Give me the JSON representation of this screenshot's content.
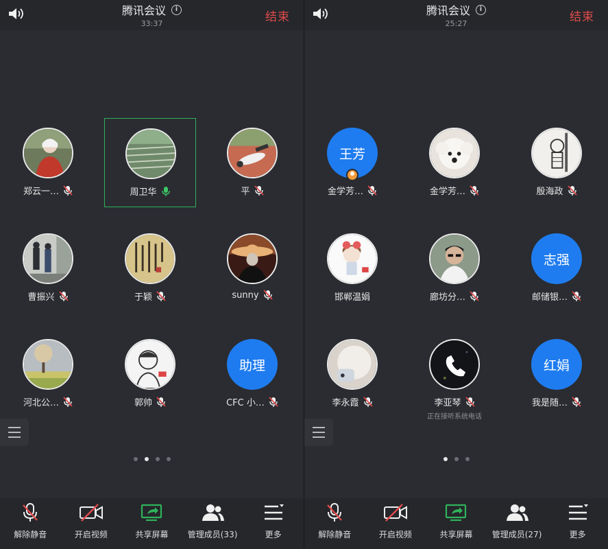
{
  "screens": [
    {
      "title": "腾讯会议",
      "timer": "33:37",
      "end_label": "结束",
      "tiles": [
        {
          "name": "郑云一…",
          "mic": "muted",
          "avatar_type": "photo",
          "avatar_icon": "woman-red-coat-photo"
        },
        {
          "name": "周卫华",
          "mic": "active",
          "avatar_type": "photo",
          "avatar_icon": "field-landscape-photo",
          "speaking": true
        },
        {
          "name": "平",
          "mic": "muted",
          "avatar_type": "photo",
          "avatar_icon": "reclining-person-photo"
        },
        {
          "name": "曹振兴",
          "mic": "muted",
          "avatar_type": "photo",
          "avatar_icon": "street-walkers-photo"
        },
        {
          "name": "于颖",
          "mic": "muted",
          "avatar_type": "photo",
          "avatar_icon": "calligraphy-photo"
        },
        {
          "name": "sunny",
          "mic": "muted",
          "avatar_type": "photo",
          "avatar_icon": "hat-silhouette-photo"
        },
        {
          "name": "河北公…",
          "mic": "muted",
          "avatar_type": "photo",
          "avatar_icon": "tree-field-photo"
        },
        {
          "name": "郭帅",
          "mic": "muted",
          "avatar_type": "photo",
          "avatar_icon": "cartoon-sketch-avatar"
        },
        {
          "name": "CFC 小…",
          "mic": "muted",
          "avatar_type": "text",
          "avatar_text": "助理"
        }
      ],
      "dots": {
        "count": 4,
        "active": 1
      },
      "toolbar": [
        {
          "label": "解除静音",
          "icon": "mic-muted-icon"
        },
        {
          "label": "开启视频",
          "icon": "video-off-icon"
        },
        {
          "label": "共享屏幕",
          "icon": "share-screen-icon"
        },
        {
          "label": "管理成员(33)",
          "icon": "members-icon"
        },
        {
          "label": "更多",
          "icon": "more-menu-icon"
        }
      ]
    },
    {
      "title": "腾讯会议",
      "timer": "25:27",
      "end_label": "结束",
      "tiles": [
        {
          "name": "金学芳…",
          "mic": "muted",
          "avatar_type": "text",
          "avatar_text": "王芳",
          "host": true
        },
        {
          "name": "金学芳…",
          "mic": "muted",
          "avatar_type": "photo",
          "avatar_icon": "white-dog-photo"
        },
        {
          "name": "殷海政",
          "mic": "muted",
          "avatar_type": "photo",
          "avatar_icon": "cartoon-character-avatar"
        },
        {
          "name": "邯郸温娟",
          "mic": "none",
          "avatar_type": "photo",
          "avatar_icon": "cartoon-girl-avatar"
        },
        {
          "name": "廊坊分…",
          "mic": "muted",
          "avatar_type": "photo",
          "avatar_icon": "man-glasses-photo"
        },
        {
          "name": "邮储银…",
          "mic": "muted",
          "avatar_type": "text",
          "avatar_text": "志强"
        },
        {
          "name": "李永霞",
          "mic": "muted",
          "avatar_type": "photo",
          "avatar_icon": "white-object-photo"
        },
        {
          "name": "李亚琴",
          "mic": "muted",
          "avatar_type": "photo",
          "avatar_icon": "phone-call-icon",
          "note": "正在接听系统电话"
        },
        {
          "name": "我是随…",
          "mic": "muted",
          "avatar_type": "text",
          "avatar_text": "红娟"
        }
      ],
      "dots": {
        "count": 3,
        "active": 0
      },
      "toolbar": [
        {
          "label": "解除静音",
          "icon": "mic-muted-icon"
        },
        {
          "label": "开启视频",
          "icon": "video-off-icon"
        },
        {
          "label": "共享屏幕",
          "icon": "share-screen-icon"
        },
        {
          "label": "管理成员(27)",
          "icon": "members-icon"
        },
        {
          "label": "更多",
          "icon": "more-menu-icon"
        }
      ]
    }
  ],
  "colors": {
    "background": "#2a2c31",
    "bar": "#25272b",
    "end_red": "#e04b4b",
    "avatar_blue": "#1f7cf0",
    "speaking_green": "#31b15a",
    "share_green": "#2fb35a"
  }
}
